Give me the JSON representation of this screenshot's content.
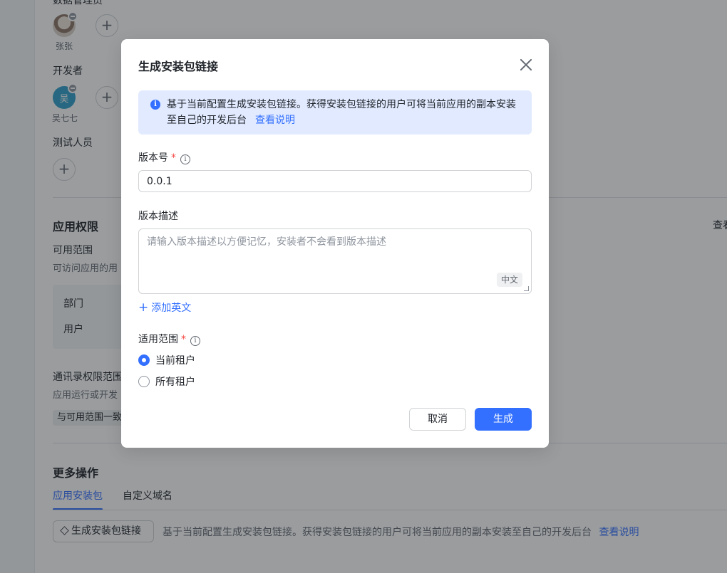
{
  "background": {
    "top_partial_label": "数据管理员",
    "admin_user": "张张",
    "developers_label": "开发者",
    "developer_avatar_letter": "吴",
    "developer_user": "吴七七",
    "testers_label": "测试人员",
    "app_permissions_title": "应用权限",
    "view_link_partial": "查看",
    "available_scope_label": "可用范围",
    "available_scope_desc_partial": "可访问应用的用",
    "scope_rows": [
      "部门",
      "用户"
    ],
    "contacts_scope_label": "通讯录权限范围",
    "contacts_scope_desc_partial": "应用运行或开发",
    "contacts_scope_tag_partial": "与可用范围一致",
    "more_actions_title": "更多操作",
    "tabs": [
      "应用安装包",
      "自定义域名"
    ],
    "generate_button": "生成安装包链接",
    "generate_desc": "基于当前配置生成安装包链接。获得安装包链接的用户可将当前应用的副本安装至自己的开发后台",
    "generate_desc_link": "查看说明"
  },
  "modal": {
    "title": "生成安装包链接",
    "info_text": "基于当前配置生成安装包链接。获得安装包链接的用户可将当前应用的副本安装至自己的开发后台",
    "info_link": "查看说明",
    "version_label": "版本号",
    "required_mark": "*",
    "version_value": "0.0.1",
    "description_label": "版本描述",
    "description_placeholder": "请输入版本描述以方便记忆，安装者不会看到版本描述",
    "lang_tag": "中文",
    "add_english": "添加英文",
    "scope_label": "适用范围",
    "scope_options": [
      "当前租户",
      "所有租户"
    ],
    "scope_selected": "当前租户",
    "cancel_button": "取消",
    "confirm_button": "生成"
  },
  "colors": {
    "primary": "#3370ff",
    "info_bg": "#e1eaff",
    "required": "#f54a45",
    "mask": "rgba(31,35,41,0.45)"
  }
}
